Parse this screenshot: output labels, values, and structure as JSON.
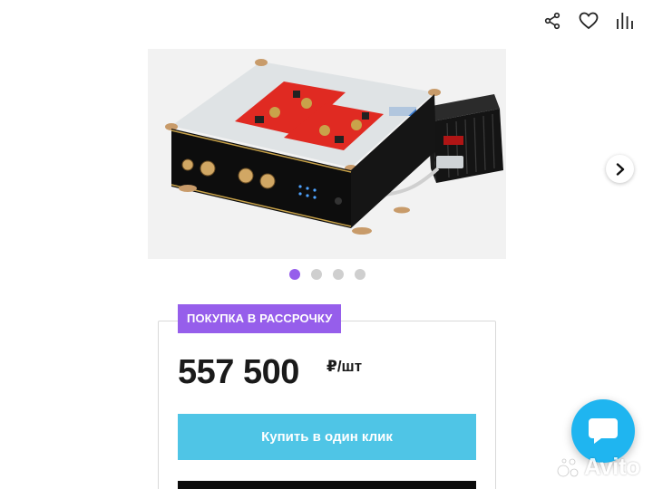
{
  "header": {
    "actions": [
      {
        "icon": "share-icon"
      },
      {
        "icon": "heart-icon"
      },
      {
        "icon": "compare-icon"
      }
    ]
  },
  "gallery": {
    "image": "product-photo",
    "dots_total": 4,
    "dots_active_index": 0,
    "next_icon": "chevron-right-icon"
  },
  "offer": {
    "badge": "ПОКУПКА В РАССРОЧКУ",
    "price": "557 500",
    "unit": "₽/шт",
    "buy_label": "Купить в один клик"
  },
  "chat": {
    "icon": "chat-bubble-icon"
  },
  "brand": {
    "logo_text": "Avito"
  },
  "colors": {
    "accent": "#965eeb",
    "button": "#4fc5e6",
    "chat": "#1fb5f0"
  }
}
